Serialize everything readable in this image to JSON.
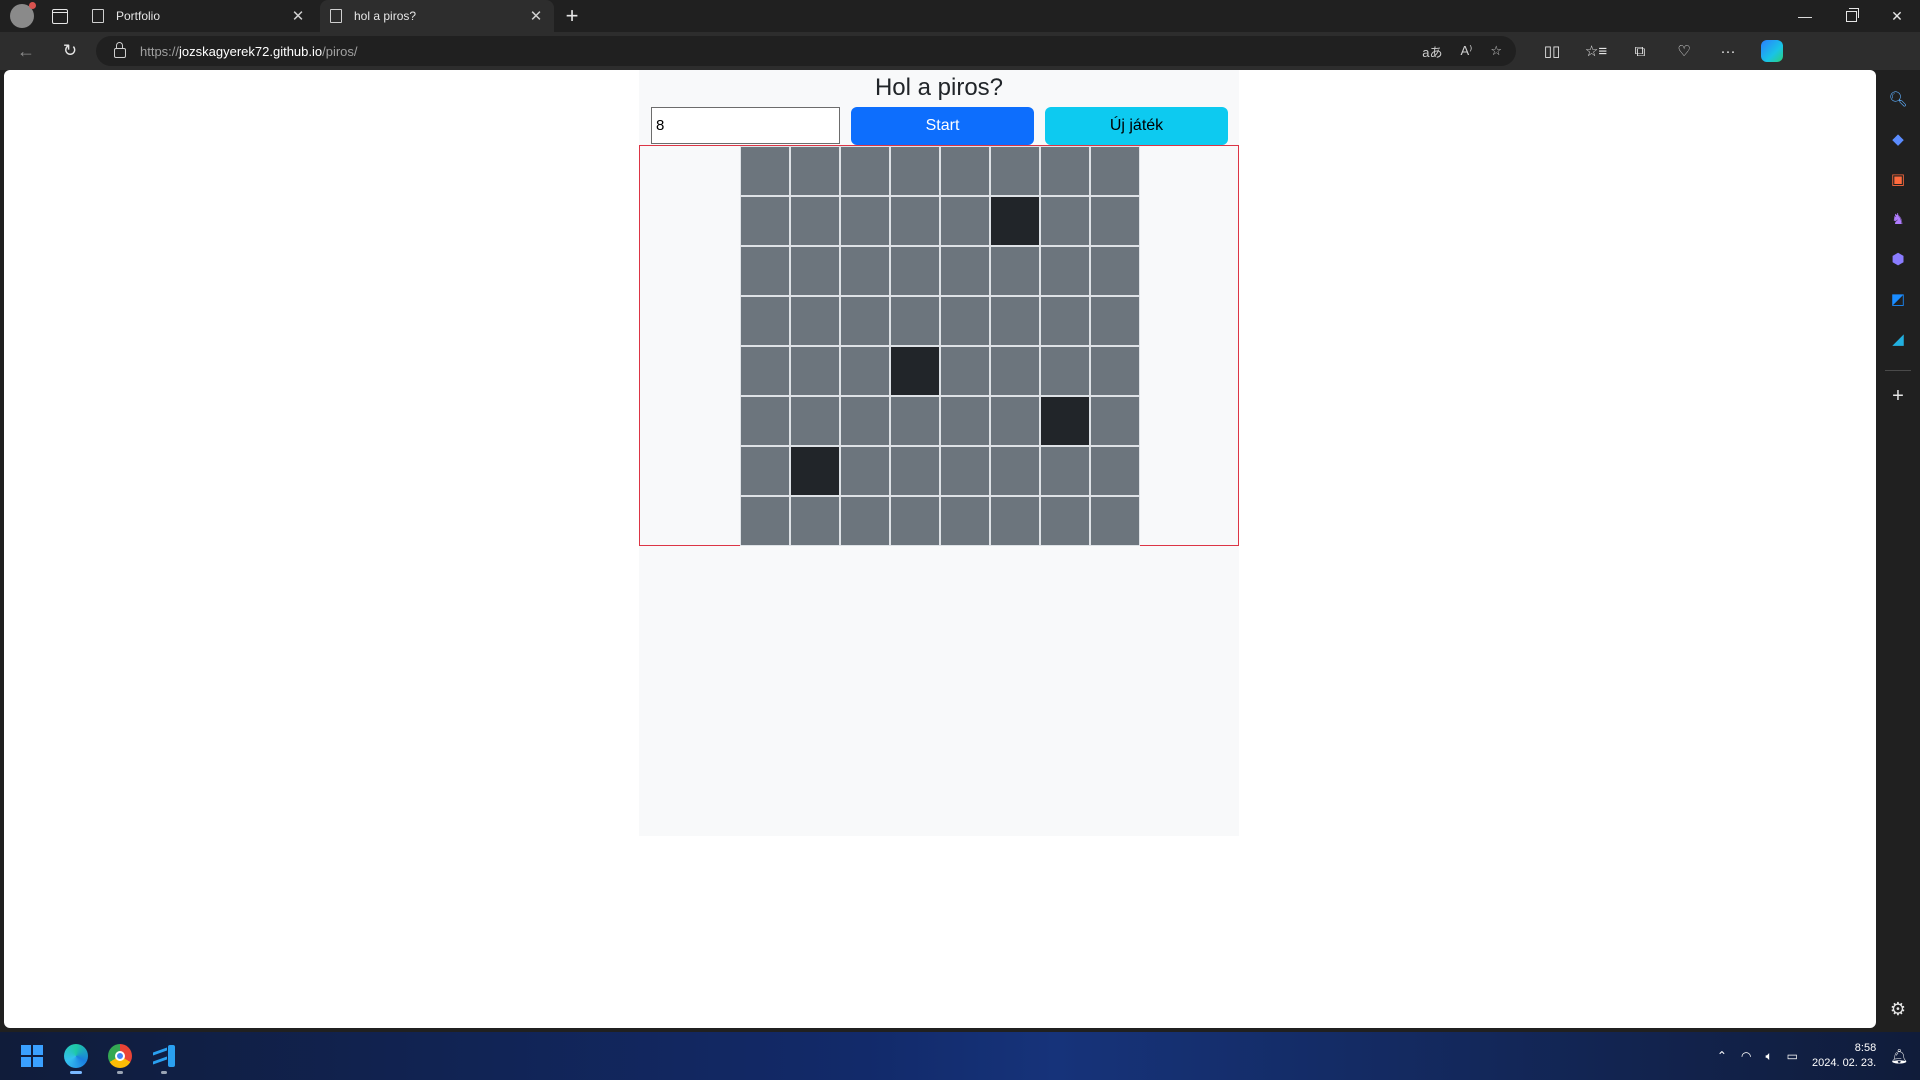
{
  "browser": {
    "tabs": [
      {
        "title": "Portfolio",
        "active": false
      },
      {
        "title": "hol a piros?",
        "active": true
      }
    ],
    "new_tab_label": "+",
    "address": {
      "scheme": "https://",
      "host": "jozskagyerek72.github.io",
      "path": "/piros/"
    },
    "toolbar_icons": [
      "translate-icon",
      "read-aloud-icon",
      "favorite-star-icon",
      "split-screen-icon",
      "favorites-icon",
      "collections-icon",
      "browser-essentials-icon",
      "more-icon",
      "copilot-icon"
    ],
    "sidebar_icons": [
      "search-icon",
      "shopping-icon",
      "tools-icon",
      "games-icon",
      "copilot-m365-icon",
      "outlook-icon",
      "drop-icon"
    ]
  },
  "page": {
    "title": "Hol a piros?",
    "size_input_value": "8",
    "start_label": "Start",
    "new_game_label": "Új játék",
    "grid": {
      "rows": 8,
      "cols": 8,
      "dark_cells": [
        [
          1,
          5
        ],
        [
          4,
          3
        ],
        [
          5,
          6
        ],
        [
          6,
          1
        ]
      ]
    },
    "colors": {
      "cell": "#6c757d",
      "dark_cell": "#212529",
      "board_border": "#dc3545",
      "start_button": "#0d6efd",
      "new_game_button": "#0dcaf0"
    }
  },
  "taskbar": {
    "apps": [
      "windows-start-icon",
      "edge-icon",
      "chrome-icon",
      "vscode-icon"
    ],
    "time": "8:58",
    "date": "2024. 02. 23."
  }
}
